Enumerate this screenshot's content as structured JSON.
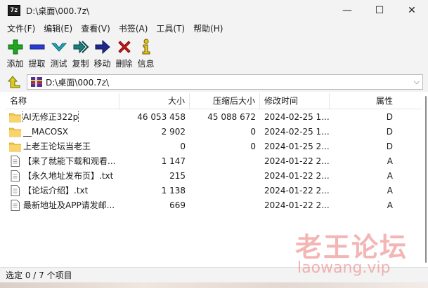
{
  "window": {
    "app_icon_text": "7z",
    "title": "D:\\桌面\\000.7z\\",
    "minimize": "—",
    "maximize": "☐",
    "close": "✕"
  },
  "menu": [
    "文件(F)",
    "编辑(E)",
    "查看(V)",
    "书签(A)",
    "工具(T)",
    "帮助(H)"
  ],
  "toolbar": {
    "add": "添加",
    "extract": "提取",
    "test": "测试",
    "copy": "复制",
    "move": "移动",
    "delete": "删除",
    "info": "信息"
  },
  "address": {
    "path": "D:\\桌面\\000.7z\\",
    "dropdown_glyph": "⌵"
  },
  "columns": {
    "name": "名称",
    "size": "大小",
    "packed": "压缩后大小",
    "modified": "修改时间",
    "attributes": "属性"
  },
  "files": [
    {
      "icon": "folder-icon",
      "name": "AI无修正322p",
      "size": "46 053 458",
      "packed": "45 088 672",
      "modified": "2024-02-25 1...",
      "attr": "D"
    },
    {
      "icon": "folder-icon",
      "name": "__MACOSX",
      "size": "2 902",
      "packed": "0",
      "modified": "2024-02-25 1...",
      "attr": "D"
    },
    {
      "icon": "folder-icon",
      "name": "上老王论坛当老王",
      "size": "0",
      "packed": "0",
      "modified": "2024-01-25 2...",
      "attr": "D"
    },
    {
      "icon": "file-icon",
      "name": "【来了就能下载和观看...",
      "size": "1 147",
      "packed": "",
      "modified": "2024-01-22 2...",
      "attr": "A"
    },
    {
      "icon": "file-icon",
      "name": "【永久地址发布页】.txt",
      "size": "215",
      "packed": "",
      "modified": "2024-01-22 2...",
      "attr": "A"
    },
    {
      "icon": "file-icon",
      "name": "【论坛介绍】.txt",
      "size": "1 138",
      "packed": "",
      "modified": "2024-01-22 2...",
      "attr": "A"
    },
    {
      "icon": "file-icon",
      "name": "最新地址及APP请发邮...",
      "size": "669",
      "packed": "",
      "modified": "2024-01-22 2...",
      "attr": "A"
    }
  ],
  "status": "选定 0 / 7 个项目",
  "watermark": {
    "line1": "老王论坛",
    "line2": "laowang.vip"
  },
  "colors": {
    "add_green": "#1fa51f",
    "extract_blue": "#2a3bd6",
    "test_cyan": "#1fa7b8",
    "copy_teal": "#1b7c7c",
    "move_navy": "#1d2a8c",
    "delete_red": "#d41414",
    "info_yellow": "#e8c51a",
    "folder_yellow": "#f5c64a"
  }
}
